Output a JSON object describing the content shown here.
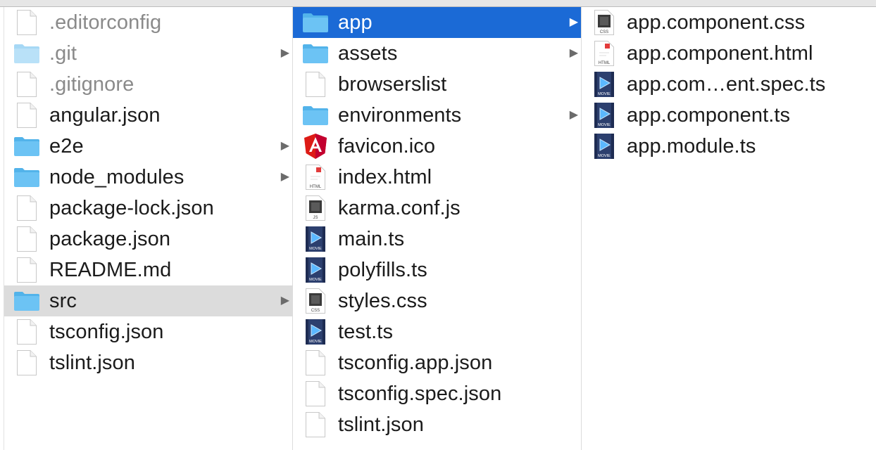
{
  "columns": [
    {
      "items": [
        {
          "label": ".editorconfig",
          "icon": "document-icon",
          "dim": true
        },
        {
          "label": ".git",
          "icon": "folder-icon",
          "dim": true,
          "has_children": true
        },
        {
          "label": ".gitignore",
          "icon": "document-icon",
          "dim": true
        },
        {
          "label": "angular.json",
          "icon": "document-icon"
        },
        {
          "label": "e2e",
          "icon": "folder-icon",
          "has_children": true
        },
        {
          "label": "node_modules",
          "icon": "folder-icon",
          "has_children": true
        },
        {
          "label": "package-lock.json",
          "icon": "document-icon"
        },
        {
          "label": "package.json",
          "icon": "document-icon"
        },
        {
          "label": "README.md",
          "icon": "document-icon"
        },
        {
          "label": "src",
          "icon": "folder-icon",
          "has_children": true,
          "selected": "gray"
        },
        {
          "label": "tsconfig.json",
          "icon": "document-icon"
        },
        {
          "label": "tslint.json",
          "icon": "document-icon"
        }
      ]
    },
    {
      "items": [
        {
          "label": "app",
          "icon": "folder-icon",
          "has_children": true,
          "selected": "blue"
        },
        {
          "label": "assets",
          "icon": "folder-icon",
          "has_children": true
        },
        {
          "label": "browserslist",
          "icon": "document-icon"
        },
        {
          "label": "environments",
          "icon": "folder-icon",
          "has_children": true
        },
        {
          "label": "favicon.ico",
          "icon": "angular-icon"
        },
        {
          "label": "index.html",
          "icon": "html-file-icon",
          "badge": "HTML"
        },
        {
          "label": "karma.conf.js",
          "icon": "js-file-icon",
          "badge": "JS"
        },
        {
          "label": "main.ts",
          "icon": "movie-file-icon",
          "badge": "MOVIE"
        },
        {
          "label": "polyfills.ts",
          "icon": "movie-file-icon",
          "badge": "MOVIE"
        },
        {
          "label": "styles.css",
          "icon": "css-file-icon",
          "badge": "CSS"
        },
        {
          "label": "test.ts",
          "icon": "movie-file-icon",
          "badge": "MOVIE"
        },
        {
          "label": "tsconfig.app.json",
          "icon": "document-icon"
        },
        {
          "label": "tsconfig.spec.json",
          "icon": "document-icon"
        },
        {
          "label": "tslint.json",
          "icon": "document-icon"
        }
      ]
    },
    {
      "items": [
        {
          "label": "app.component.css",
          "icon": "css-file-icon",
          "badge": "CSS"
        },
        {
          "label": "app.component.html",
          "icon": "html-file-icon",
          "badge": "HTML"
        },
        {
          "label": "app.com…ent.spec.ts",
          "icon": "movie-file-icon",
          "badge": "MOVIE"
        },
        {
          "label": "app.component.ts",
          "icon": "movie-file-icon",
          "badge": "MOVIE"
        },
        {
          "label": "app.module.ts",
          "icon": "movie-file-icon",
          "badge": "MOVIE"
        }
      ]
    }
  ],
  "colors": {
    "selection_blue": "#1b6ad6",
    "selection_gray": "#dcdcdc",
    "folder": "#6cc3f4",
    "text": "#1b1b1b",
    "dim_text": "#8a8a8a"
  }
}
